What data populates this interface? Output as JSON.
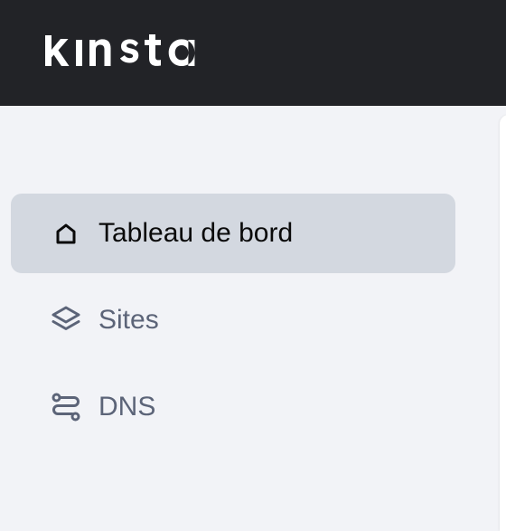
{
  "header": {
    "logo_text": "kinsta",
    "background": "#222327"
  },
  "sidebar": {
    "items": [
      {
        "label": "Tableau de bord",
        "icon": "home-icon",
        "active": true
      },
      {
        "label": "Sites",
        "icon": "layers-icon",
        "active": false
      },
      {
        "label": "DNS",
        "icon": "routes-icon",
        "active": false
      }
    ]
  },
  "colors": {
    "active_bg": "#d3d8e0",
    "page_bg": "#f2f3f7",
    "inactive_text": "#5c6478",
    "active_text": "#0a0a0a"
  }
}
